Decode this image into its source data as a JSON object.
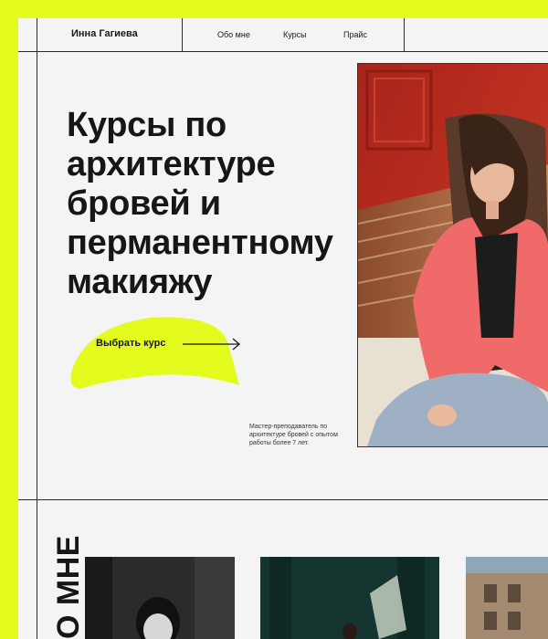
{
  "header": {
    "brand": "Инна Гагиева",
    "nav": [
      "Обо мне",
      "Курсы",
      "Прайс"
    ]
  },
  "hero": {
    "title_lines": [
      "Курсы по",
      "архитектуре",
      "бровей  и",
      "перманентному",
      "макияжу"
    ],
    "cta_label": "Выбрать курс",
    "bio": "Мастер-преподаватель по архитектуре бровей с опытом работы более 7 лет."
  },
  "about": {
    "section_label": "О МНЕ"
  },
  "colors": {
    "accent": "#e4fb1e",
    "text": "#161616",
    "background": "#f4f4f4",
    "shirt": "#f06a6a",
    "wall": "#b32a1d"
  },
  "icons": {
    "cta_arrow": "arrow-right-icon"
  }
}
